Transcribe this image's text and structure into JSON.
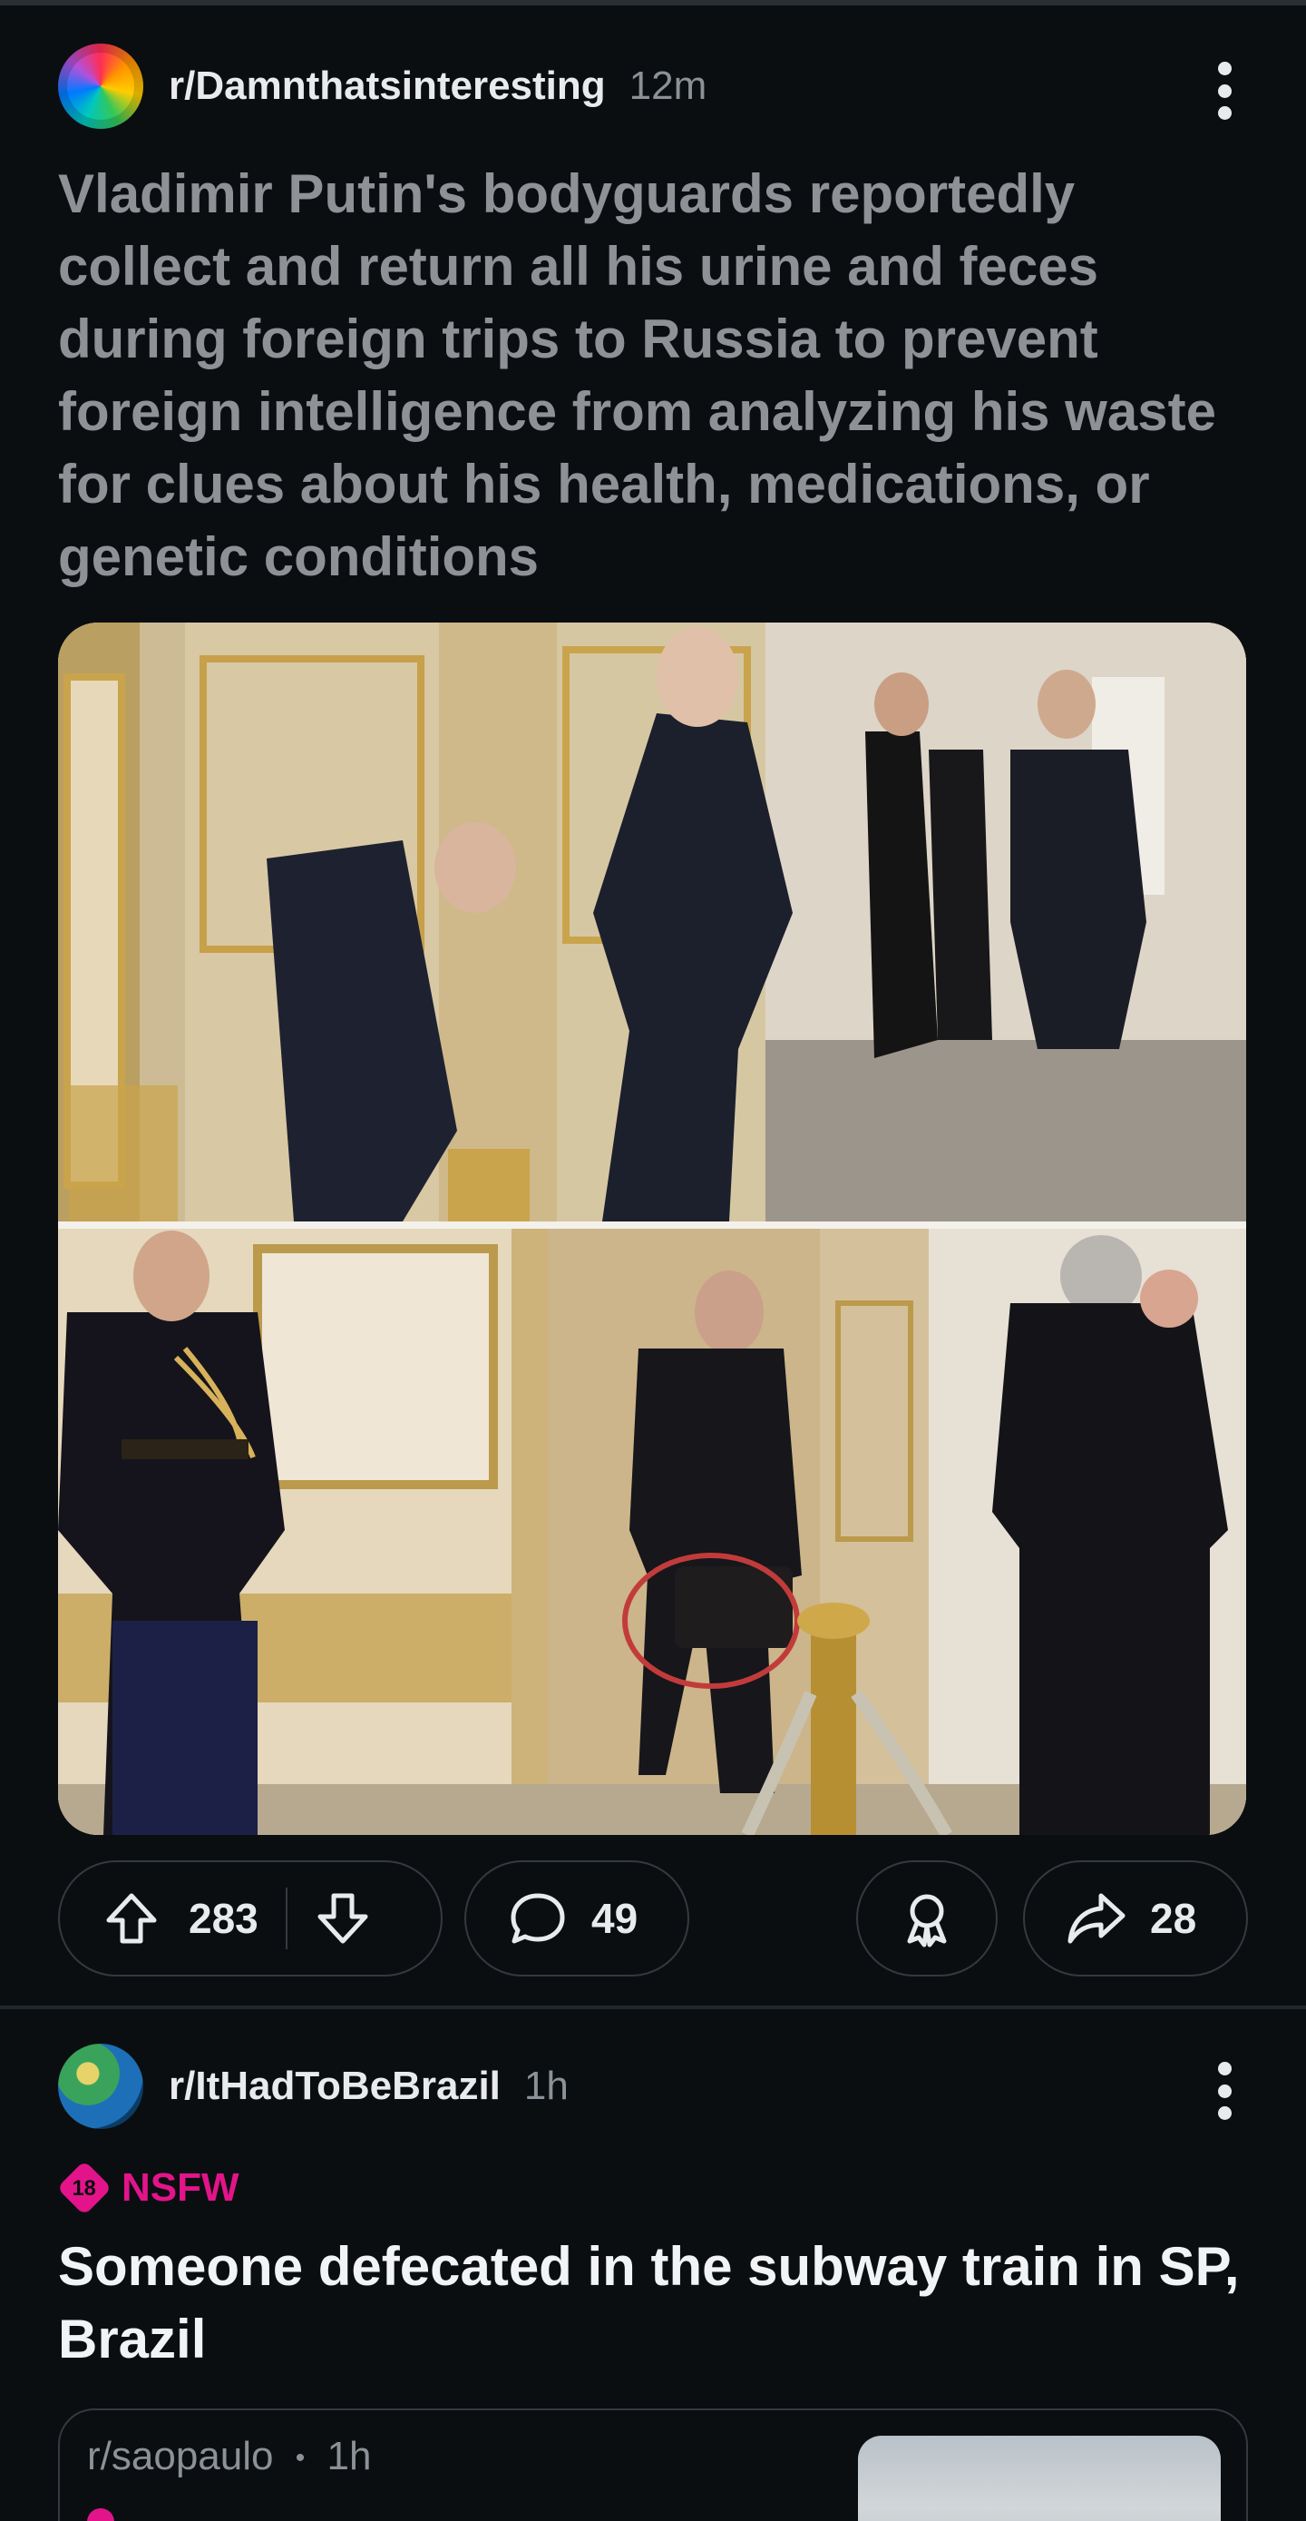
{
  "feed": {
    "posts": [
      {
        "subreddit": "r/Damnthatsinteresting",
        "time": "12m",
        "title": "Vladimir Putin's bodyguards reportedly collect and return all his urine and feces during foreign trips to Russia to prevent foreign intelligence from analyzing his waste for clues about his health, medications, or genetic conditions",
        "upvotes": "283",
        "comments": "49",
        "shares": "28"
      },
      {
        "subreddit": "r/ItHadToBeBrazil",
        "time": "1h",
        "nsfw_number": "18",
        "nsfw_label": "NSFW",
        "title": "Someone defecated in the subway train in SP, Brazil",
        "crosspost": {
          "subreddit": "r/saopaulo",
          "separator": "•",
          "time": "1h"
        }
      }
    ]
  },
  "colors": {
    "background": "#0b0e11",
    "nsfw": "#e3148a",
    "border": "#343a3f"
  },
  "icons": [
    "kebab-menu-icon",
    "upvote-icon",
    "downvote-icon",
    "comment-icon",
    "award-icon",
    "share-icon",
    "nsfw-18-icon"
  ]
}
